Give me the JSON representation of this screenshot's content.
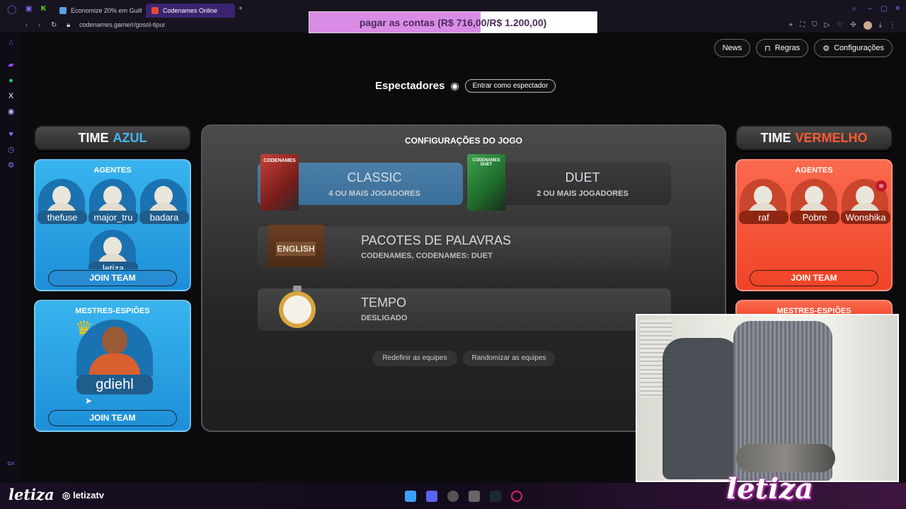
{
  "browser": {
    "tabs": [
      {
        "label": "Economize 20% em Guilty",
        "active": false
      },
      {
        "label": "Codenames Online",
        "active": true
      }
    ],
    "new_tab": "+",
    "url": "codenames.game/r/gosol-tipur"
  },
  "overlay": {
    "goal_text": "pagar as contas (R$ 716,00/R$ 1.200,00)",
    "progress": 0.5967,
    "color": "#d98ce6"
  },
  "topbar": {
    "news": "News",
    "rules": "Regras",
    "settings": "Configurações"
  },
  "spectators": {
    "title": "Espectadores",
    "join": "Entrar como espectador"
  },
  "blue_team": {
    "header_prefix": "TIME",
    "header_color_word": "AZUL",
    "agents_title": "AGENTES",
    "agents": [
      "thefuse",
      "major_tru",
      "badara",
      "letiza"
    ],
    "join": "JOIN TEAM",
    "spymasters_title": "MESTRES-ESPIÕES",
    "spymaster": "gdiehl",
    "join2": "JOIN TEAM",
    "color": "#45b6f2"
  },
  "red_team": {
    "header_prefix": "TIME",
    "header_color_word": "VERMELHO",
    "agents_title": "AGENTES",
    "agents": [
      "raf",
      "Pobre",
      "Wonshika"
    ],
    "join": "JOIN TEAM",
    "spymasters_title": "MESTRES-ESPIÕES",
    "color": "#ff5a35"
  },
  "game_settings": {
    "title": "CONFIGURAÇÕES DO JOGO",
    "classic_box": "CODENAMES",
    "duet_box": "CODENAMES DUET",
    "classic": {
      "name": "CLASSIC",
      "sub": "4 OU MAIS JOGADORES"
    },
    "duet": {
      "name": "DUET",
      "sub": "2 OU MAIS JOGADORES"
    },
    "packs": {
      "title": "PACOTES DE PALAVRAS",
      "sub": "CODENAMES, CODENAMES: DUET",
      "badge": "ENGLISH"
    },
    "timer": {
      "title": "TEMPO",
      "sub": "DESLIGADO"
    },
    "reset_teams": "Redefinir as equipes",
    "randomize_teams": "Randomizar as equipes"
  },
  "stream": {
    "brand": "letiza",
    "handle": "letizatv",
    "brand_big": "letiza"
  }
}
